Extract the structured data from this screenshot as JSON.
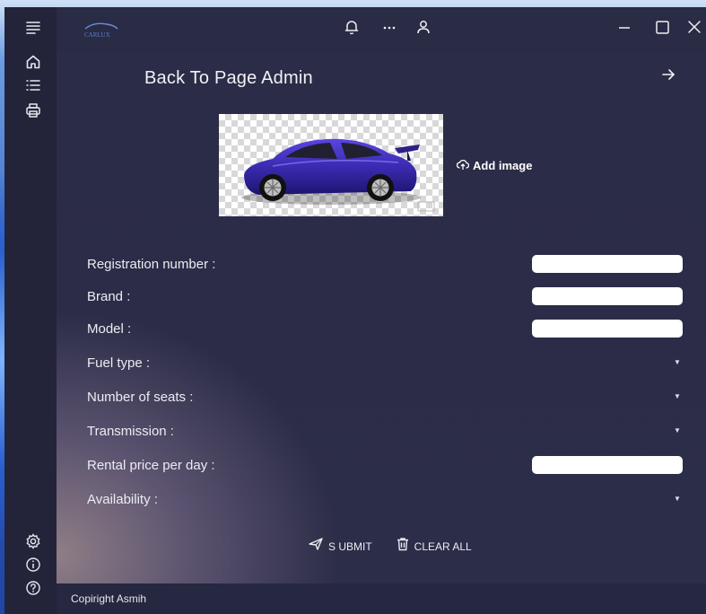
{
  "window": {
    "logo_text": "CARLUX"
  },
  "rail": {
    "top_icons": [
      "menu-icon",
      "home-icon",
      "list-icon",
      "print-icon"
    ],
    "bottom_icons": [
      "settings-icon",
      "info-icon",
      "help-icon"
    ]
  },
  "titlebar": {
    "icons": [
      "bell-icon",
      "more-icon",
      "user-icon"
    ],
    "controls": [
      "minimize-icon",
      "maximize-icon",
      "close-icon"
    ]
  },
  "header": {
    "title": "Back To Page Admin"
  },
  "image": {
    "add_label": "Add image"
  },
  "form": {
    "fields": [
      {
        "label": "Registration number :",
        "type": "text",
        "value": ""
      },
      {
        "label": "Brand :",
        "type": "text",
        "value": ""
      },
      {
        "label": "Model :",
        "type": "text",
        "value": ""
      },
      {
        "label": "Fuel type :",
        "type": "select",
        "value": ""
      },
      {
        "label": "Number of seats :",
        "type": "select",
        "value": ""
      },
      {
        "label": "Transmission :",
        "type": "select",
        "value": ""
      },
      {
        "label": "Rental price per day :",
        "type": "text",
        "value": ""
      },
      {
        "label": "Availability :",
        "type": "select",
        "value": ""
      }
    ]
  },
  "actions": {
    "submit_label": "S UBMIT",
    "clear_label": "CLEAR ALL"
  },
  "footer": {
    "text": "Copiright Asmih"
  },
  "colors": {
    "window_bg": "#2a2b45",
    "rail_bg": "#232439",
    "car_body": "#3a2bb0"
  }
}
